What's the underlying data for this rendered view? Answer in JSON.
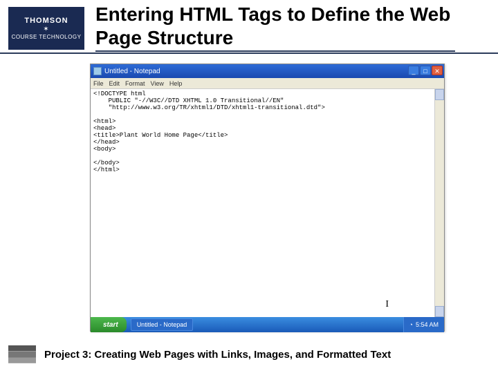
{
  "slide": {
    "title": "Entering HTML Tags to Define the Web Page Structure",
    "footer": "Project 3: Creating Web Pages with Links, Images, and Formatted Text"
  },
  "logo": {
    "top": "THOMSON",
    "star": "✶",
    "bottom": "COURSE TECHNOLOGY"
  },
  "notepad": {
    "title": "Untitled - Notepad",
    "menu": {
      "file": "File",
      "edit": "Edit",
      "format": "Format",
      "view": "View",
      "help": "Help"
    },
    "content": "<!DOCTYPE html\n    PUBLIC \"-//W3C//DTD XHTML 1.0 Transitional//EN\"\n    \"http://www.w3.org/TR/xhtml1/DTD/xhtml1-transitional.dtd\">\n\n<html>\n<head>\n<title>Plant World Home Page</title>\n</head>\n<body>\n\n</body>\n</html>",
    "window_controls": {
      "minimize": "_",
      "maximize": "□",
      "close": "✕"
    }
  },
  "taskbar": {
    "start": "start",
    "task1": "Untitled - Notepad",
    "time": "5:54 AM"
  }
}
